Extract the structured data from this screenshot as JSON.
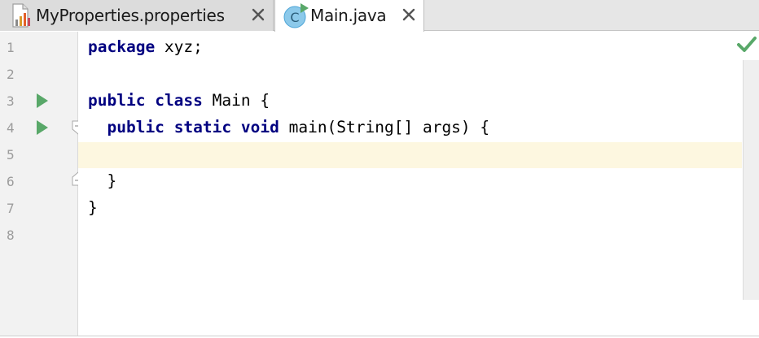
{
  "tabs": [
    {
      "label": "MyProperties.properties",
      "icon": "properties-file-icon",
      "active": false
    },
    {
      "label": "Main.java",
      "icon": "java-class-icon",
      "active": true
    }
  ],
  "close_glyph": "✕",
  "class_icon_letter": "C",
  "editor": {
    "caret_line": 5,
    "inspection_status": "no-problems-check-icon",
    "lines": [
      {
        "number": "1",
        "run_marker": false,
        "fold_marker": ""
      },
      {
        "number": "2",
        "run_marker": false,
        "fold_marker": ""
      },
      {
        "number": "3",
        "run_marker": true,
        "fold_marker": ""
      },
      {
        "number": "4",
        "run_marker": true,
        "fold_marker": "open"
      },
      {
        "number": "5",
        "run_marker": false,
        "fold_marker": ""
      },
      {
        "number": "6",
        "run_marker": false,
        "fold_marker": "close"
      },
      {
        "number": "7",
        "run_marker": false,
        "fold_marker": ""
      },
      {
        "number": "8",
        "run_marker": false,
        "fold_marker": ""
      }
    ],
    "code": {
      "line1": {
        "kw1": "package",
        "rest": " xyz;"
      },
      "line3": {
        "kw1": "public",
        "sp": " ",
        "kw2": "class",
        "rest": " Main {"
      },
      "line4": {
        "indent": "  ",
        "kw1": "public",
        "sp1": " ",
        "kw2": "static",
        "sp2": " ",
        "kw3": "void",
        "rest": " main(String[] args) {"
      },
      "line6": {
        "text": "  }"
      },
      "line7": {
        "text": "}"
      }
    }
  },
  "colors": {
    "keyword": "#000080",
    "run_marker": "#59a869",
    "caret_row": "#fdf7e0",
    "check": "#59a869",
    "class_icon": "#4aa3d6"
  }
}
